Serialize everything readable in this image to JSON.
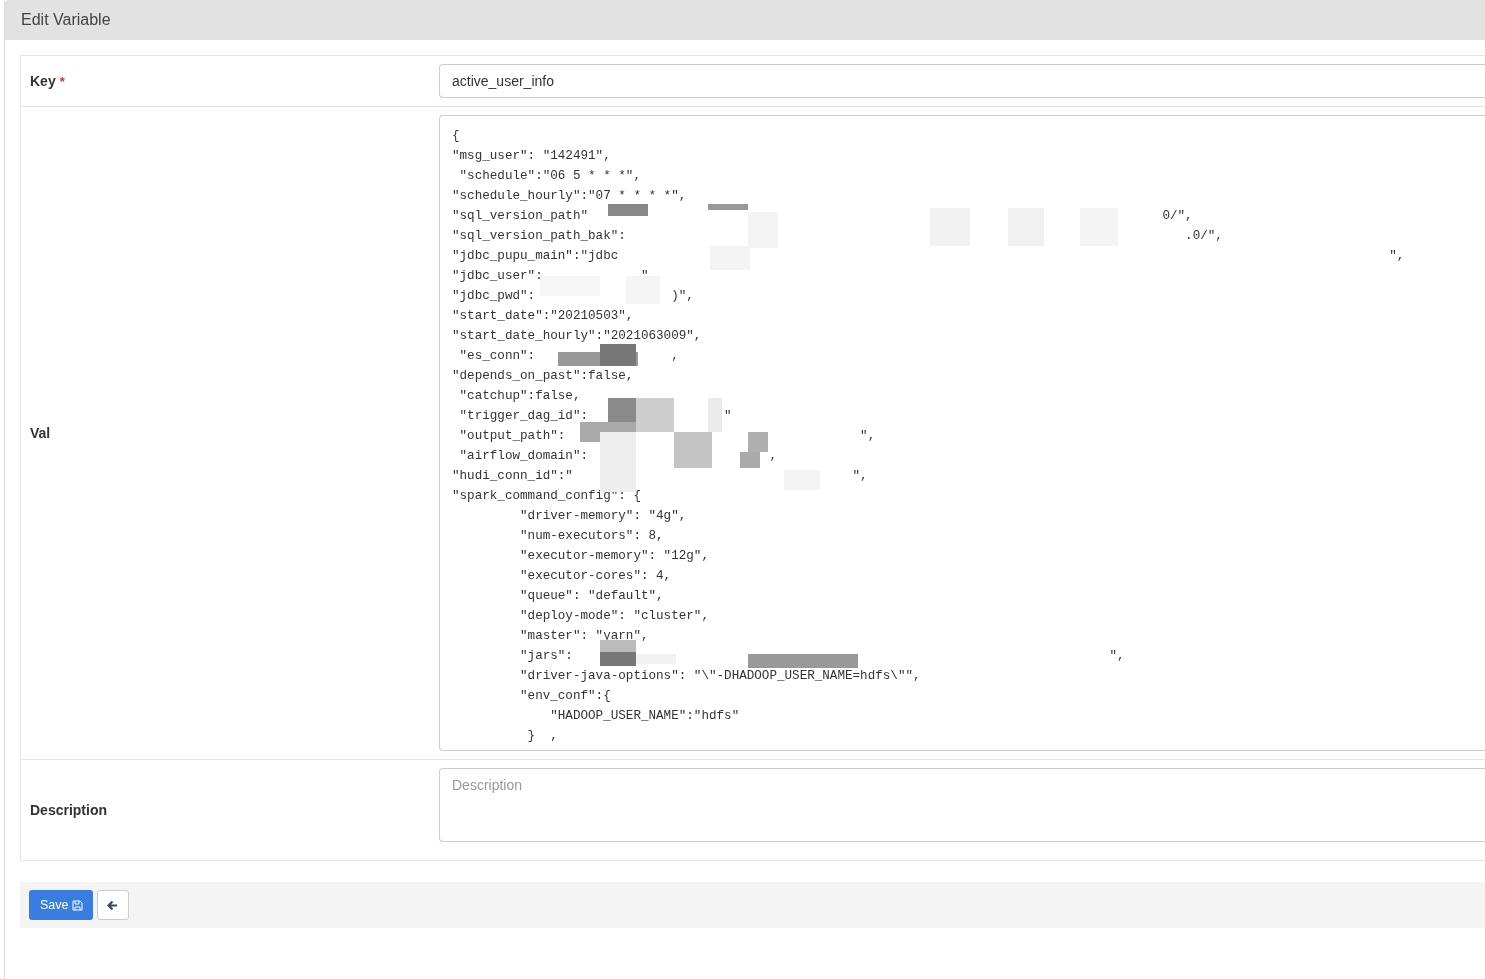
{
  "panel": {
    "title": "Edit Variable"
  },
  "fields": [
    {
      "kind": "input",
      "label": "Key",
      "required_mark": "*",
      "value": "active_user_info"
    },
    {
      "kind": "code",
      "label": "Val",
      "lines": [
        "{",
        "\"msg_user\": \"142491\",",
        " \"schedule\":\"06 5 * * *\",",
        "\"schedule_hourly\":\"07 * * * *\",",
        "\"sql_version_path\"                                                                            0/\",",
        "\"sql_version_path_bak\":                                                                          .0/\",",
        "\"jdbc_pupu_main\":\"jdbc                                                                                                      \",",
        "\"jdbc_user\":             \",",
        "\"jdbc_pwd\":                  )\",",
        "\"start_date\":\"20210503\",",
        "\"start_date_hourly\":\"2021063009\",",
        " \"es_conn\":                  ,",
        "\"depends_on_past\":false,",
        " \"catchup\":false,",
        " \"trigger_dag_id\":                  \"",
        " \"output_path\":                                       \",",
        " \"airflow_domain\":                        ,",
        "\"hudi_conn_id\":\"                                     \",",
        "\"spark_command_config\": {",
        "         \"driver-memory\": \"4g\",",
        "         \"num-executors\": 8,",
        "         \"executor-memory\": \"12g\",",
        "         \"executor-cores\": 4,",
        "         \"queue\": \"default\",",
        "         \"deploy-mode\": \"cluster\",",
        "         \"master\": \"yarn\",",
        "         \"jars\":                                                                       \",",
        "         \"driver-java-options\": \"\\\"-DHADOOP_USER_NAME=hdfs\\\"\",",
        "         \"env_conf\":{",
        "             \"HADOOP_USER_NAME\":\"hdfs\"",
        "          }  ,"
      ]
    },
    {
      "kind": "textarea",
      "label": "Description",
      "placeholder": "Description"
    }
  ],
  "actions": {
    "save": "Save"
  }
}
